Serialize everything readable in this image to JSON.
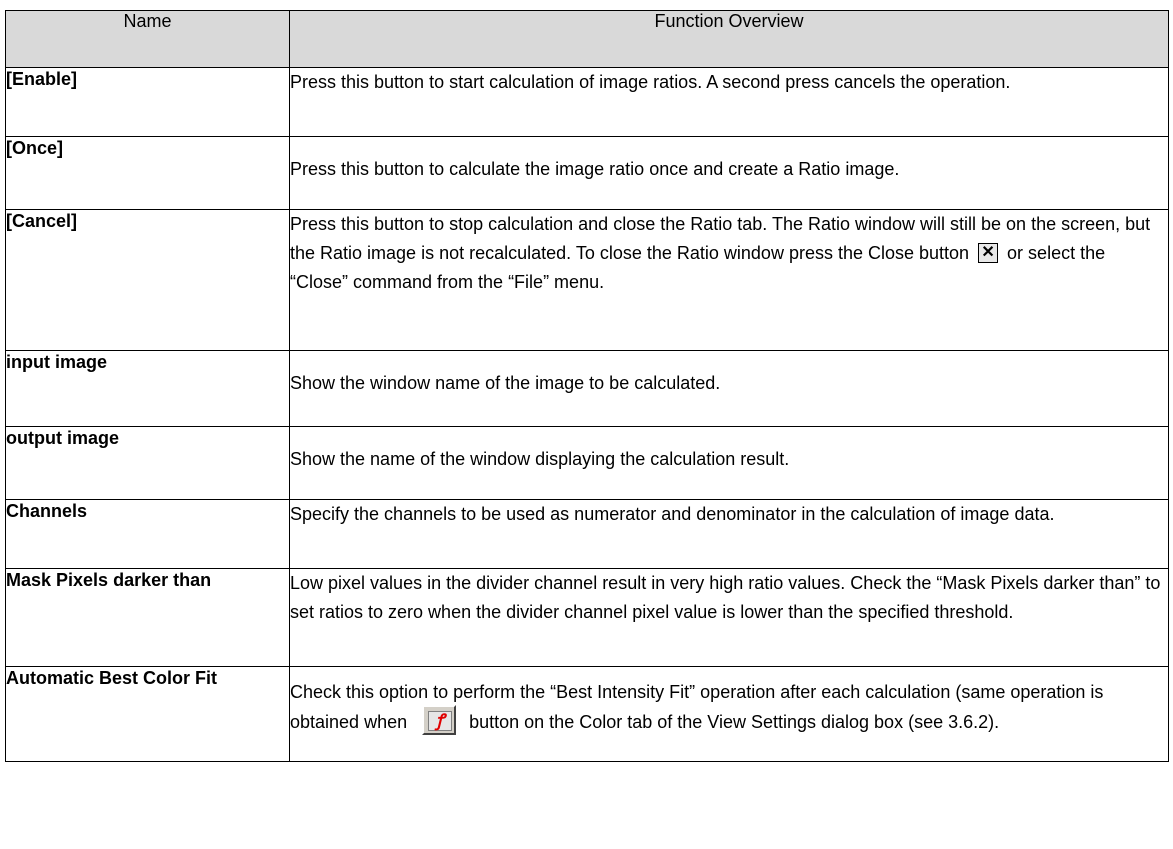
{
  "table": {
    "headers": {
      "name": "Name",
      "function": "Function Overview"
    },
    "rows": [
      {
        "name": "[Enable]",
        "desc": "Press this button to start calculation of image ratios. A second press cancels the operation."
      },
      {
        "name": "[Once]",
        "desc": "Press this button to calculate the image ratio once and create a Ratio image."
      },
      {
        "name": "[Cancel]",
        "desc_before": "Press this button to stop calculation and close the Ratio tab. The Ratio window will still be on the screen, but the Ratio image is not recalculated. To close the Ratio window press the Close button",
        "desc_after": "or select the “Close” command from the “File” menu."
      },
      {
        "name": "input image",
        "desc": "Show the window name of the image to be calculated."
      },
      {
        "name": "output image",
        "desc": "Show the name of the window displaying the calculation result."
      },
      {
        "name": "Channels",
        "desc": "Specify the channels to be used as numerator and denominator in the calculation of image data."
      },
      {
        "name": "Mask Pixels darker than",
        "desc": "Low pixel values in the divider channel result in very high ratio values. Check the “Mask Pixels darker than” to set ratios to zero when the divider channel pixel value is lower than the specified threshold."
      },
      {
        "name": "Automatic Best Color Fit",
        "desc_before": "Check this option to perform the “Best Intensity Fit” operation after each calculation (same operation is obtained when",
        "desc_after": "button on the Color tab of the View Settings dialog box (see 3.6.2)."
      }
    ]
  },
  "icons": {
    "close": {
      "name": "close-icon",
      "glyph": "✕"
    },
    "fit": {
      "name": "best-fit-icon",
      "glyph": "ꝭ",
      "color": "#e00000"
    }
  },
  "colors": {
    "header_bg": "#d9d9d9",
    "border": "#000000"
  }
}
